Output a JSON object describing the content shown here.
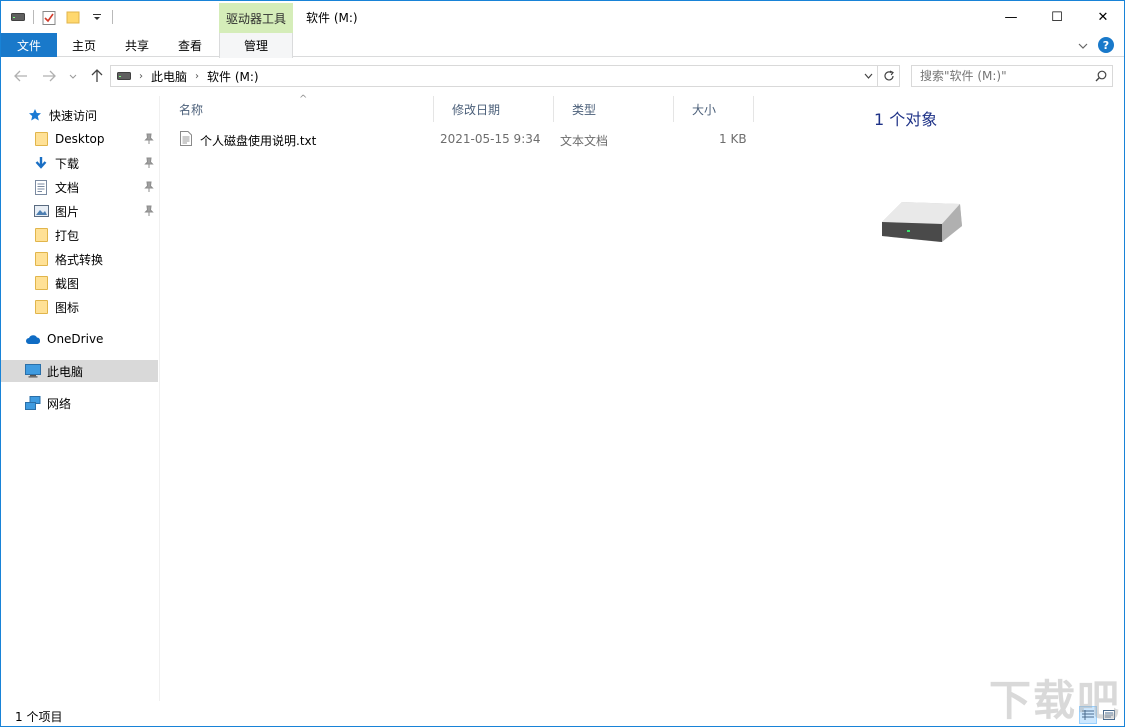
{
  "window": {
    "title": "软件 (M:)",
    "context_tab_header": "驱动器工具",
    "minimize_glyph": "—",
    "maximize_glyph": "☐",
    "close_glyph": "✕"
  },
  "ribbon": {
    "tabs": [
      {
        "label": "文件"
      },
      {
        "label": "主页"
      },
      {
        "label": "共享"
      },
      {
        "label": "查看"
      },
      {
        "label": "管理"
      }
    ],
    "help_glyph": "?"
  },
  "address": {
    "crumbs": [
      "此电脑",
      "软件 (M:)"
    ],
    "search_placeholder": "搜索\"软件 (M:)\""
  },
  "navigation": {
    "quick_access": "快速访问",
    "pinned": [
      {
        "label": "Desktop",
        "icon": "folder-icon"
      },
      {
        "label": "下载",
        "icon": "download-arrow-icon"
      },
      {
        "label": "文档",
        "icon": "document-icon"
      },
      {
        "label": "图片",
        "icon": "pictures-icon"
      }
    ],
    "folders": [
      {
        "label": "打包"
      },
      {
        "label": "格式转换"
      },
      {
        "label": "截图"
      },
      {
        "label": "图标"
      }
    ],
    "onedrive": "OneDrive",
    "this_pc": "此电脑",
    "network": "网络"
  },
  "file_list": {
    "columns": [
      "名称",
      "修改日期",
      "类型",
      "大小"
    ],
    "rows": [
      {
        "name": "个人磁盘使用说明.txt",
        "modified": "2021-05-15 9:34",
        "type": "文本文档",
        "size": "1 KB"
      }
    ]
  },
  "preview": {
    "count_label": "1 个对象",
    "icon": "hard-drive-icon"
  },
  "status": {
    "item_count": "1 个项目"
  },
  "watermark": "下载吧",
  "colors": {
    "accent": "#1979ca",
    "context_tab": "#d5edb9",
    "selection": "#d9d9d9",
    "header_text": "#4c607a",
    "preview_heading": "#1e3287"
  }
}
